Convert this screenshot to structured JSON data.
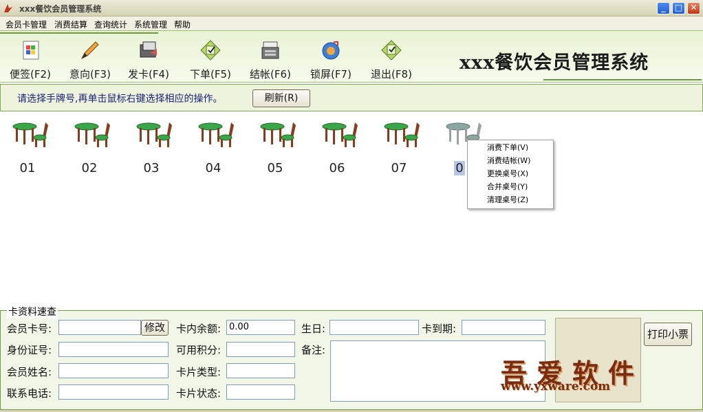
{
  "window": {
    "title": "xxx餐饮会员管理系统",
    "minimize": "_",
    "maximize": "□",
    "close": "✕"
  },
  "menu": [
    "会员卡管理",
    "消费结算",
    "查询统计",
    "系统管理",
    "帮助"
  ],
  "toolbar": {
    "items": [
      {
        "label": "便签(F2)",
        "icon": "windows-flag-icon"
      },
      {
        "label": "意向(F3)",
        "icon": "pencil-icon"
      },
      {
        "label": "发卡(F4)",
        "icon": "card-issue-icon"
      },
      {
        "label": "下单(F5)",
        "icon": "order-icon"
      },
      {
        "label": "结帐(F6)",
        "icon": "cash-register-icon"
      },
      {
        "label": "锁屏(F7)",
        "icon": "lock-screen-icon"
      },
      {
        "label": "退出(F8)",
        "icon": "exit-icon"
      }
    ],
    "brand_title": "xxx餐饮会员管理系统"
  },
  "hint": {
    "text": "请选择手牌号,再单击鼠标右键选择相应的操作。",
    "refresh_label": "刷新(R)"
  },
  "tables": [
    "01",
    "02",
    "03",
    "04",
    "05",
    "06",
    "07",
    "0"
  ],
  "context_menu": [
    "消费下单(V)",
    "消费结帐(W)",
    "更换桌号(X)",
    "合并桌号(Y)",
    "清理桌号(Z)"
  ],
  "card_panel": {
    "legend": "卡资料速查",
    "member_card_label": "会员卡号:",
    "edit_label": "修改",
    "balance_label": "卡内余额:",
    "balance_value": "0.00",
    "birthday_label": "生日:",
    "expiry_label": "卡到期:",
    "print_label": "打印小票",
    "id_label": "身份证号:",
    "points_label": "可用积分:",
    "remark_label": "备注:",
    "name_label": "会员姓名:",
    "card_type_label": "卡片类型:",
    "phone_label": "联系电话:",
    "card_status_label": "卡片状态:"
  },
  "watermark": {
    "cn": "吾爱软件",
    "url": "www.yxware.com"
  },
  "colors": {
    "toolbar_bg": "#e9f3d4",
    "accent_border": "#6e9a44",
    "hint_text": "#1a237e",
    "table_top": "#3aa64a",
    "chair_wood": "#8b3a1a"
  }
}
